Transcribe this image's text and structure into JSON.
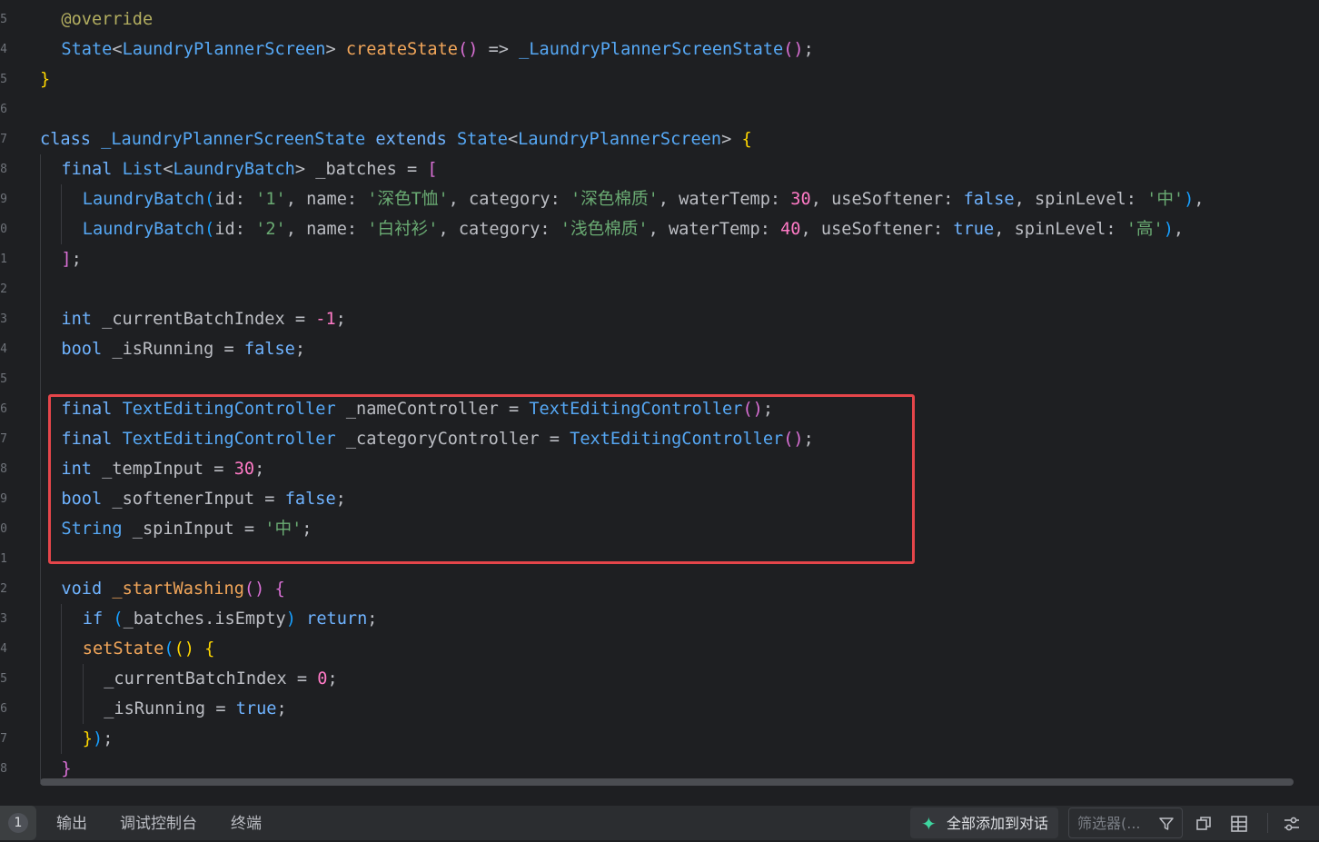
{
  "editor": {
    "gutter_numbers": [
      "5",
      "4",
      "5",
      "6",
      "7",
      "8",
      "9",
      "0",
      "1",
      "2",
      "3",
      "4",
      "5",
      "6",
      "7",
      "8",
      "9",
      "0",
      "1",
      "2",
      "3",
      "4",
      "5",
      "6",
      "7",
      "8"
    ],
    "lines": [
      [
        [
          "ann",
          "@override"
        ]
      ],
      [
        [
          "ty",
          "State"
        ],
        [
          "df",
          "<"
        ],
        [
          "cls",
          "LaundryPlannerScreen"
        ],
        [
          "df",
          "> "
        ],
        [
          "fn",
          "createState"
        ],
        [
          "p2",
          "()"
        ],
        [
          "df",
          " => "
        ],
        [
          "cls",
          "_LaundryPlannerScreenState"
        ],
        [
          "p2",
          "()"
        ],
        [
          "df",
          ";"
        ]
      ],
      [
        [
          "p1",
          "}"
        ]
      ],
      [],
      [
        [
          "kw",
          "class "
        ],
        [
          "cls",
          "_LaundryPlannerScreenState "
        ],
        [
          "kw",
          "extends "
        ],
        [
          "ty",
          "State"
        ],
        [
          "df",
          "<"
        ],
        [
          "cls",
          "LaundryPlannerScreen"
        ],
        [
          "df",
          "> "
        ],
        [
          "p1",
          "{"
        ]
      ],
      [
        [
          "kw",
          "final "
        ],
        [
          "ty",
          "List"
        ],
        [
          "df",
          "<"
        ],
        [
          "cls",
          "LaundryBatch"
        ],
        [
          "df",
          "> _batches = "
        ],
        [
          "p2",
          "["
        ]
      ],
      [
        [
          "cls",
          "LaundryBatch"
        ],
        [
          "p3",
          "("
        ],
        [
          "df",
          "id: "
        ],
        [
          "str",
          "'1'"
        ],
        [
          "df",
          ", name: "
        ],
        [
          "str",
          "'深色T恤'"
        ],
        [
          "df",
          ", category: "
        ],
        [
          "str",
          "'深色棉质'"
        ],
        [
          "df",
          ", waterTemp: "
        ],
        [
          "num",
          "30"
        ],
        [
          "df",
          ", useSoftener: "
        ],
        [
          "kw",
          "false"
        ],
        [
          "df",
          ", spinLevel: "
        ],
        [
          "str",
          "'中'"
        ],
        [
          "p3",
          ")"
        ],
        [
          "df",
          ","
        ]
      ],
      [
        [
          "cls",
          "LaundryBatch"
        ],
        [
          "p3",
          "("
        ],
        [
          "df",
          "id: "
        ],
        [
          "str",
          "'2'"
        ],
        [
          "df",
          ", name: "
        ],
        [
          "str",
          "'白衬衫'"
        ],
        [
          "df",
          ", category: "
        ],
        [
          "str",
          "'浅色棉质'"
        ],
        [
          "df",
          ", waterTemp: "
        ],
        [
          "num",
          "40"
        ],
        [
          "df",
          ", useSoftener: "
        ],
        [
          "kw",
          "true"
        ],
        [
          "df",
          ", spinLevel: "
        ],
        [
          "str",
          "'高'"
        ],
        [
          "p3",
          ")"
        ],
        [
          "df",
          ","
        ]
      ],
      [
        [
          "p2",
          "]"
        ],
        [
          "df",
          ";"
        ]
      ],
      [],
      [
        [
          "kw",
          "int "
        ],
        [
          "df",
          "_currentBatchIndex = "
        ],
        [
          "num",
          "-1"
        ],
        [
          "df",
          ";"
        ]
      ],
      [
        [
          "kw",
          "bool "
        ],
        [
          "df",
          "_isRunning = "
        ],
        [
          "kw",
          "false"
        ],
        [
          "df",
          ";"
        ]
      ],
      [],
      [
        [
          "kw",
          "final "
        ],
        [
          "cls",
          "TextEditingController "
        ],
        [
          "df",
          "_nameController = "
        ],
        [
          "cls",
          "TextEditingController"
        ],
        [
          "p2",
          "()"
        ],
        [
          "df",
          ";"
        ]
      ],
      [
        [
          "kw",
          "final "
        ],
        [
          "cls",
          "TextEditingController "
        ],
        [
          "df",
          "_categoryController = "
        ],
        [
          "cls",
          "TextEditingController"
        ],
        [
          "p2",
          "()"
        ],
        [
          "df",
          ";"
        ]
      ],
      [
        [
          "kw",
          "int "
        ],
        [
          "df",
          "_tempInput = "
        ],
        [
          "num",
          "30"
        ],
        [
          "df",
          ";"
        ]
      ],
      [
        [
          "kw",
          "bool "
        ],
        [
          "df",
          "_softenerInput = "
        ],
        [
          "kw",
          "false"
        ],
        [
          "df",
          ";"
        ]
      ],
      [
        [
          "ty",
          "String "
        ],
        [
          "df",
          "_spinInput = "
        ],
        [
          "str",
          "'中'"
        ],
        [
          "df",
          ";"
        ]
      ],
      [],
      [
        [
          "kw",
          "void "
        ],
        [
          "fn",
          "_startWashing"
        ],
        [
          "p2",
          "()"
        ],
        [
          "df",
          " "
        ],
        [
          "p2",
          "{"
        ]
      ],
      [
        [
          "kw",
          "if "
        ],
        [
          "p3",
          "("
        ],
        [
          "df",
          "_batches.isEmpty"
        ],
        [
          "p3",
          ")"
        ],
        [
          "df",
          " "
        ],
        [
          "kw",
          "return"
        ],
        [
          "df",
          ";"
        ]
      ],
      [
        [
          "fn",
          "setState"
        ],
        [
          "p3",
          "("
        ],
        [
          "p1",
          "()"
        ],
        [
          "df",
          " "
        ],
        [
          "p1",
          "{"
        ]
      ],
      [
        [
          "df",
          "_currentBatchIndex = "
        ],
        [
          "num",
          "0"
        ],
        [
          "df",
          ";"
        ]
      ],
      [
        [
          "df",
          "_isRunning = "
        ],
        [
          "kw",
          "true"
        ],
        [
          "df",
          ";"
        ]
      ],
      [
        [
          "p1",
          "}"
        ],
        [
          "p3",
          ")"
        ],
        [
          "df",
          ";"
        ]
      ],
      [
        [
          "p2",
          "}"
        ]
      ]
    ]
  },
  "panel": {
    "problems_count": "1",
    "tabs": [
      "输出",
      "调试控制台",
      "终端"
    ],
    "add_all_label": "全部添加到对话",
    "filter_placeholder": "筛选器(...",
    "icons": [
      "sparkle-icon",
      "filter-icon",
      "copy-icon",
      "layout-icon",
      "settings-sliders-icon"
    ]
  },
  "colors": {
    "background": "#1e1f22",
    "keyword": "#6fb3ff",
    "string": "#6aab73",
    "number": "#ff7ac6",
    "function": "#f2a65a",
    "highlight_border": "#e5454a",
    "accent": "#3ed6a0"
  }
}
